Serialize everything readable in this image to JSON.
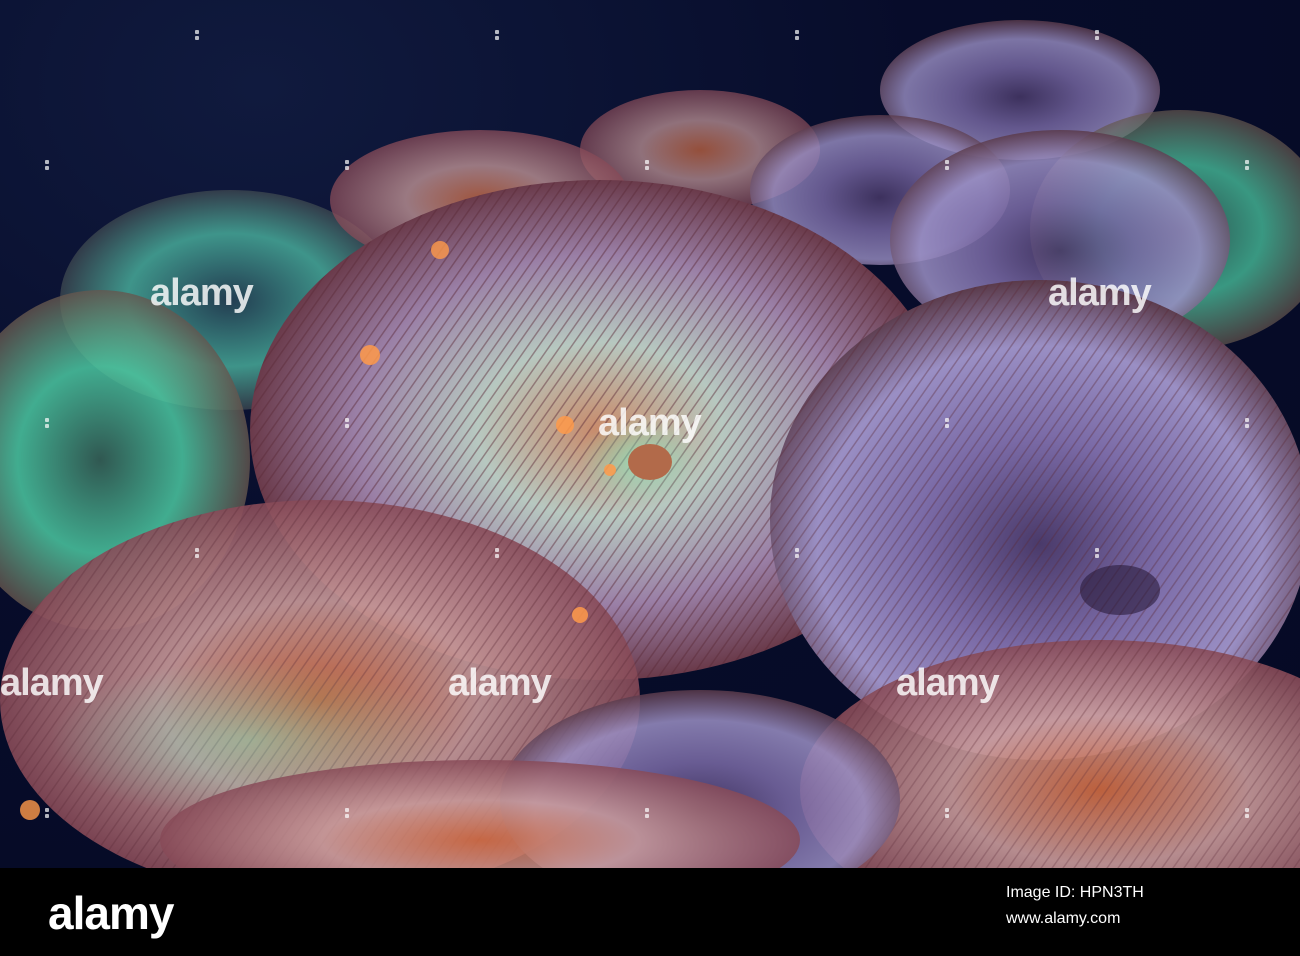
{
  "photo": {
    "subject": "",
    "colors": {
      "background": "#070c2a",
      "coral_purple": "#8a6a9a",
      "coral_green": "#5fe0b8",
      "coral_orange": "#c25a3a"
    }
  },
  "watermark": {
    "text": "alamy"
  },
  "footer": {
    "logo_text": "alamy",
    "image_id": "Image ID: HPN3TH",
    "url": "www.alamy.com"
  }
}
